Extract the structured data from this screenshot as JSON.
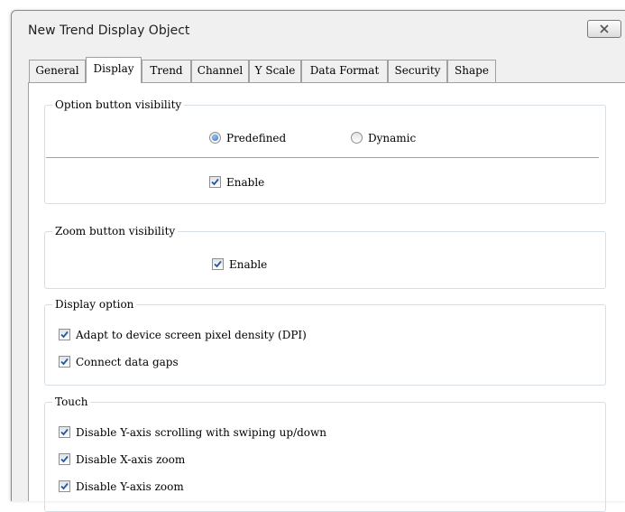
{
  "dialog": {
    "title": "New Trend Display Object"
  },
  "tabs": [
    {
      "label": "General"
    },
    {
      "label": "Display"
    },
    {
      "label": "Trend"
    },
    {
      "label": "Channel"
    },
    {
      "label": "Y Scale"
    },
    {
      "label": "Data Format"
    },
    {
      "label": "Security"
    },
    {
      "label": "Shape"
    }
  ],
  "active_tab": "Display",
  "option_button_group": {
    "title": "Option button visibility",
    "predefined_label": "Predefined",
    "dynamic_label": "Dynamic",
    "selected": "Predefined",
    "enable_label": "Enable",
    "enable_checked": true
  },
  "zoom_button_group": {
    "title": "Zoom button visibility",
    "enable_label": "Enable",
    "enable_checked": true
  },
  "display_option_group": {
    "title": "Display option",
    "adapt_dpi_label": "Adapt to device screen pixel density (DPI)",
    "adapt_dpi_checked": true,
    "connect_gaps_label": "Connect data gaps",
    "connect_gaps_checked": true
  },
  "touch_group": {
    "title": "Touch",
    "disable_y_scroll_label": "Disable Y-axis scrolling with swiping up/down",
    "disable_y_scroll_checked": true,
    "disable_x_zoom_label": "Disable X-axis zoom",
    "disable_x_zoom_checked": true,
    "disable_y_zoom_label": "Disable Y-axis zoom",
    "disable_y_zoom_checked": true
  },
  "colors": {
    "accent": "#2a6fc2",
    "checkmark": "#1f5aa6",
    "group_border": "#d5dfe5"
  }
}
